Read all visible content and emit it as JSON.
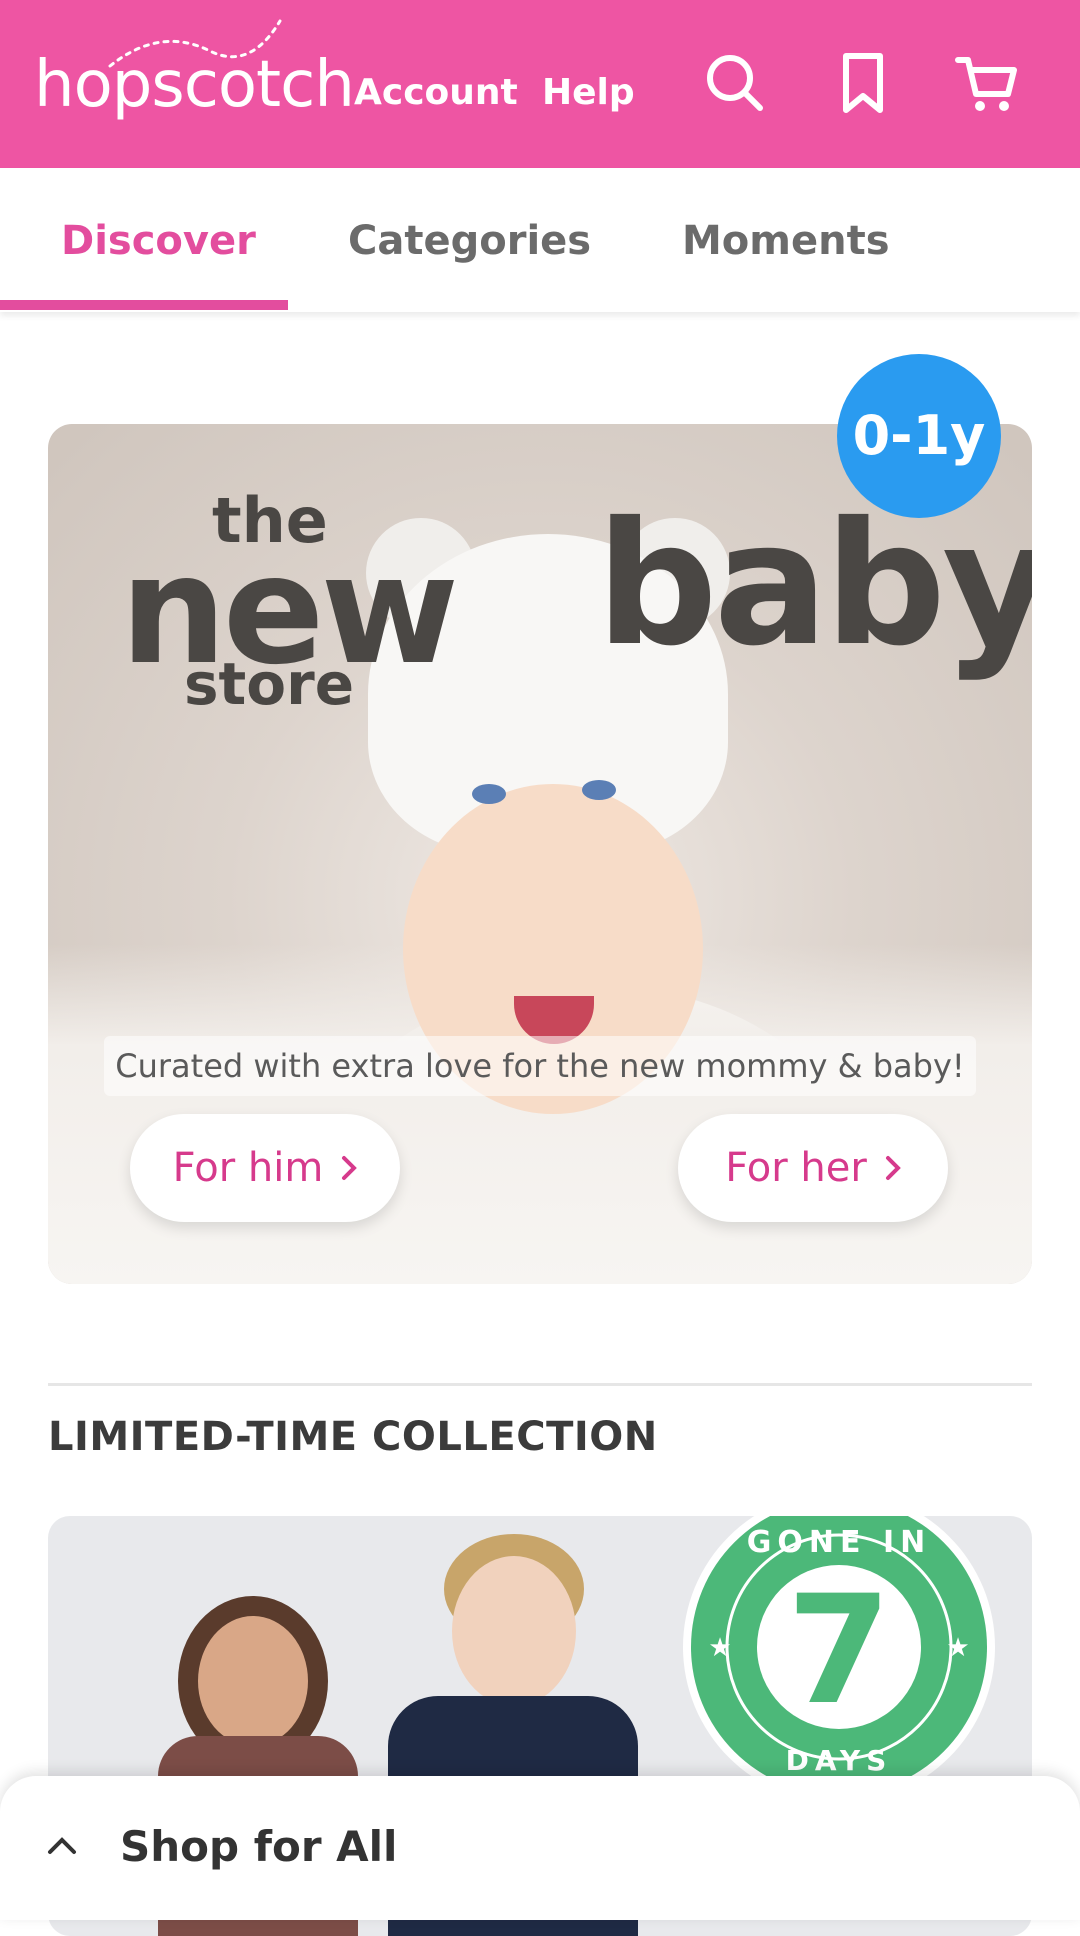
{
  "header": {
    "logo_text": "hopscotch",
    "nav": [
      "Account",
      "Help"
    ],
    "icons": [
      "search-icon",
      "bookmark-icon",
      "cart-icon"
    ],
    "brand_color": "#ee55a3"
  },
  "tabs": [
    {
      "label": "Discover",
      "active": true
    },
    {
      "label": "Categories",
      "active": false
    },
    {
      "label": "Moments",
      "active": false
    }
  ],
  "banner": {
    "age_badge": "0-1y",
    "title_the": "the",
    "title_new": "new",
    "title_baby": "baby",
    "title_store": "store",
    "tagline": "Curated with extra love for the new mommy & baby!",
    "buttons": [
      "For him",
      "For her"
    ]
  },
  "section": {
    "title": "LIMITED-TIME COLLECTION",
    "badge_top": "GONE IN",
    "badge_number": "7",
    "badge_bottom": "DAYS",
    "badge_color": "#4cb879"
  },
  "bottom_sheet": {
    "label": "Shop for All"
  }
}
